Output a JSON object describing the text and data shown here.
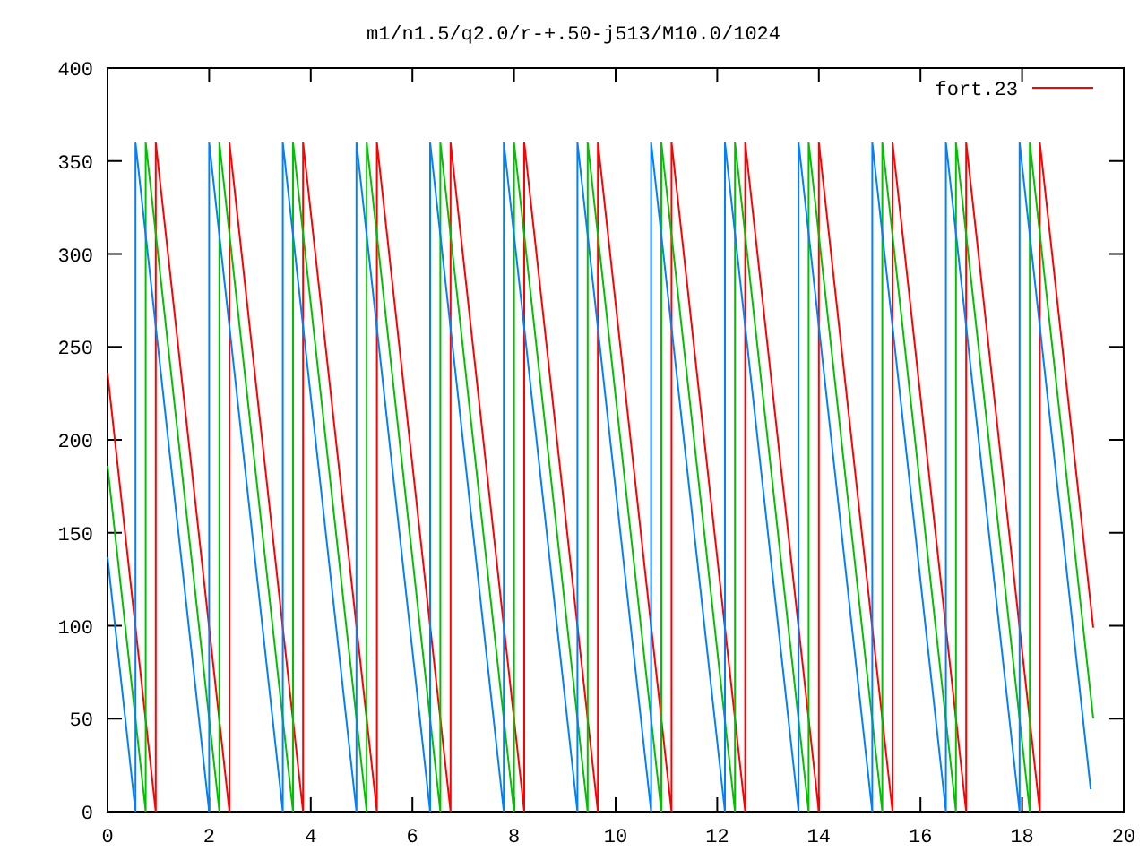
{
  "plot": {
    "chart_data": {
      "type": "line",
      "title": "m1/n1.5/q2.0/r-+.50-j513/M10.0/1024",
      "xlim": [
        0,
        20
      ],
      "ylim": [
        0,
        400
      ],
      "xticks": [
        0,
        2,
        4,
        6,
        8,
        10,
        12,
        14,
        16,
        18,
        20
      ],
      "yticks": [
        0,
        50,
        100,
        150,
        200,
        250,
        300,
        350,
        400
      ],
      "series": [
        {
          "name": "fort.23",
          "color": "#ff0000",
          "x": [
            0,
            0.95,
            0.95,
            2.4,
            2.4,
            3.85,
            3.85,
            5.3,
            5.3,
            6.75,
            6.75,
            8.2,
            8.2,
            9.65,
            9.65,
            11.1,
            11.1,
            12.55,
            12.55,
            14,
            14,
            15.45,
            15.45,
            16.9,
            16.9,
            18.35,
            18.35,
            19.4
          ],
          "values": [
            236,
            0,
            360,
            0,
            360,
            0,
            360,
            0,
            360,
            0,
            360,
            0,
            360,
            0,
            360,
            0,
            360,
            0,
            360,
            0,
            360,
            0,
            360,
            0,
            360,
            0,
            360,
            99
          ]
        },
        {
          "color": "#00c000",
          "x": [
            0,
            0.75,
            0.75,
            2.2,
            2.2,
            3.65,
            3.65,
            5.1,
            5.1,
            6.55,
            6.55,
            8,
            8,
            9.45,
            9.45,
            10.9,
            10.9,
            12.35,
            12.35,
            13.8,
            13.8,
            15.25,
            15.25,
            16.7,
            16.7,
            18.15,
            18.15,
            19.4
          ],
          "values": [
            186,
            0,
            360,
            0,
            360,
            0,
            360,
            0,
            360,
            0,
            360,
            0,
            360,
            0,
            360,
            0,
            360,
            0,
            360,
            0,
            360,
            0,
            360,
            0,
            360,
            0,
            360,
            50
          ]
        },
        {
          "color": "#0080ff",
          "x": [
            0,
            0.55,
            0.55,
            2,
            2,
            3.45,
            3.45,
            4.9,
            4.9,
            6.35,
            6.35,
            7.8,
            7.8,
            9.25,
            9.25,
            10.7,
            10.7,
            12.15,
            12.15,
            13.6,
            13.6,
            15.05,
            15.05,
            16.5,
            16.5,
            17.95,
            17.95,
            19.35
          ],
          "values": [
            137,
            0,
            360,
            0,
            360,
            0,
            360,
            0,
            360,
            0,
            360,
            0,
            360,
            0,
            360,
            0,
            360,
            0,
            360,
            0,
            360,
            0,
            360,
            0,
            360,
            0,
            360,
            12
          ]
        }
      ]
    }
  }
}
